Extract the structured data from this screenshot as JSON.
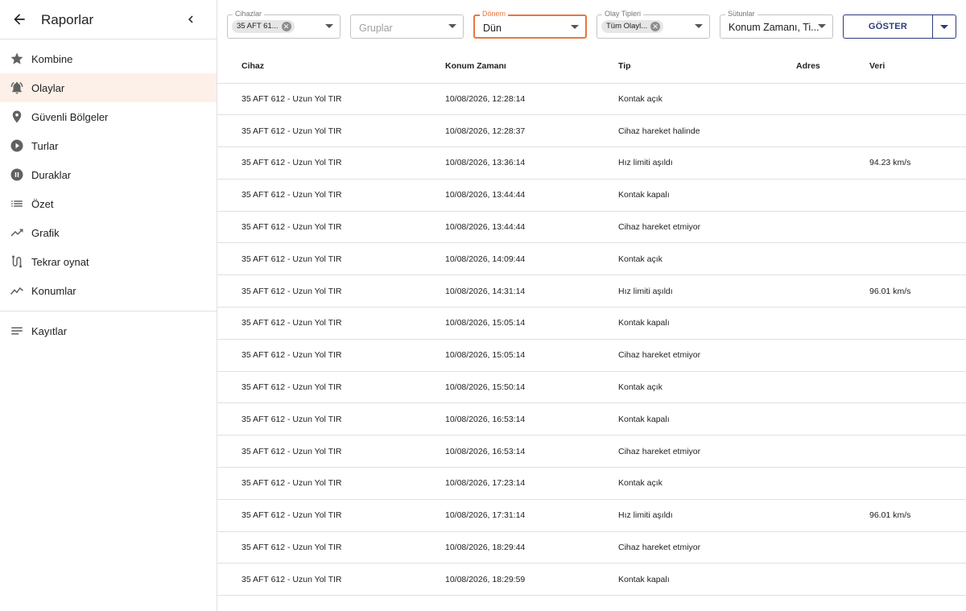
{
  "sidebar": {
    "title": "Raporlar",
    "items": [
      {
        "label": "Kombine",
        "icon": "star-icon",
        "active": false
      },
      {
        "label": "Olaylar",
        "icon": "bell-icon",
        "active": true
      },
      {
        "label": "Güvenli Bölgeler",
        "icon": "location-pin-icon",
        "active": false
      },
      {
        "label": "Turlar",
        "icon": "play-circle-icon",
        "active": false
      },
      {
        "label": "Duraklar",
        "icon": "pause-circle-icon",
        "active": false
      },
      {
        "label": "Özet",
        "icon": "list-icon",
        "active": false
      },
      {
        "label": "Grafik",
        "icon": "trending-up-icon",
        "active": false
      },
      {
        "label": "Tekrar oynat",
        "icon": "route-icon",
        "active": false
      },
      {
        "label": "Konumlar",
        "icon": "timeline-icon",
        "active": false
      }
    ],
    "bottom_items": [
      {
        "label": "Kayıtlar",
        "icon": "notes-icon"
      }
    ]
  },
  "filters": {
    "devices": {
      "legend": "Cihazlar",
      "chip": "35 AFT 61..."
    },
    "groups": {
      "placeholder": "Gruplar"
    },
    "period": {
      "legend": "Dönem",
      "value": "Dün"
    },
    "event_types": {
      "legend": "Olay Tipleri",
      "chip": "Tüm Olayl..."
    },
    "columns": {
      "legend": "Sütunlar",
      "value": "Konum Zamanı, Ti..."
    },
    "show_label": "GÖSTER"
  },
  "table": {
    "headers": [
      "Cihaz",
      "Konum Zamanı",
      "Tip",
      "Adres",
      "Veri"
    ],
    "rows": [
      [
        "35 AFT 612 - Uzun Yol TIR",
        "10/08/2026, 12:28:14",
        "Kontak açık",
        "",
        ""
      ],
      [
        "35 AFT 612 - Uzun Yol TIR",
        "10/08/2026, 12:28:37",
        "Cihaz hareket halinde",
        "",
        ""
      ],
      [
        "35 AFT 612 - Uzun Yol TIR",
        "10/08/2026, 13:36:14",
        "Hız limiti aşıldı",
        "",
        "94.23 km/s"
      ],
      [
        "35 AFT 612 - Uzun Yol TIR",
        "10/08/2026, 13:44:44",
        "Kontak kapalı",
        "",
        ""
      ],
      [
        "35 AFT 612 - Uzun Yol TIR",
        "10/08/2026, 13:44:44",
        "Cihaz hareket etmiyor",
        "",
        ""
      ],
      [
        "35 AFT 612 - Uzun Yol TIR",
        "10/08/2026, 14:09:44",
        "Kontak açık",
        "",
        ""
      ],
      [
        "35 AFT 612 - Uzun Yol TIR",
        "10/08/2026, 14:31:14",
        "Hız limiti aşıldı",
        "",
        "96.01 km/s"
      ],
      [
        "35 AFT 612 - Uzun Yol TIR",
        "10/08/2026, 15:05:14",
        "Kontak kapalı",
        "",
        ""
      ],
      [
        "35 AFT 612 - Uzun Yol TIR",
        "10/08/2026, 15:05:14",
        "Cihaz hareket etmiyor",
        "",
        ""
      ],
      [
        "35 AFT 612 - Uzun Yol TIR",
        "10/08/2026, 15:50:14",
        "Kontak açık",
        "",
        ""
      ],
      [
        "35 AFT 612 - Uzun Yol TIR",
        "10/08/2026, 16:53:14",
        "Kontak kapalı",
        "",
        ""
      ],
      [
        "35 AFT 612 - Uzun Yol TIR",
        "10/08/2026, 16:53:14",
        "Cihaz hareket etmiyor",
        "",
        ""
      ],
      [
        "35 AFT 612 - Uzun Yol TIR",
        "10/08/2026, 17:23:14",
        "Kontak açık",
        "",
        ""
      ],
      [
        "35 AFT 612 - Uzun Yol TIR",
        "10/08/2026, 17:31:14",
        "Hız limiti aşıldı",
        "",
        "96.01 km/s"
      ],
      [
        "35 AFT 612 - Uzun Yol TIR",
        "10/08/2026, 18:29:44",
        "Cihaz hareket etmiyor",
        "",
        ""
      ],
      [
        "35 AFT 612 - Uzun Yol TIR",
        "10/08/2026, 18:29:59",
        "Kontak kapalı",
        "",
        ""
      ]
    ]
  },
  "colors": {
    "accent": "#e8773d",
    "active_bg": "#fdf0e9",
    "primary": "#2b3a7a",
    "icon": "#616161"
  }
}
